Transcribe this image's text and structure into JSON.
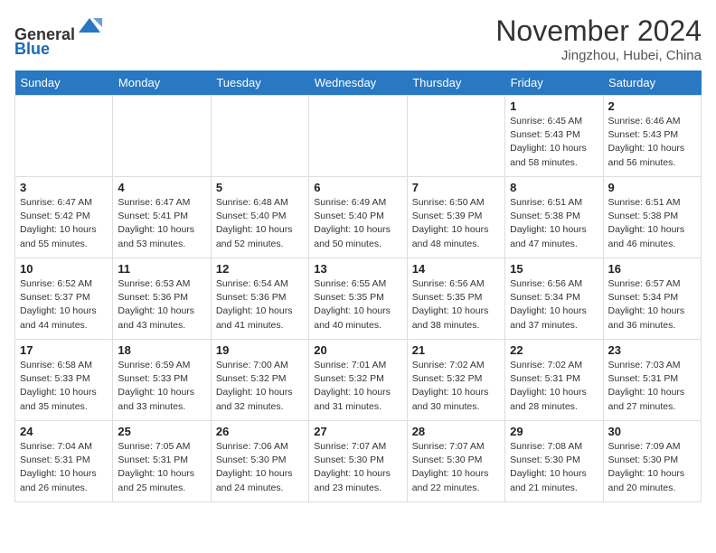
{
  "header": {
    "logo_general": "General",
    "logo_blue": "Blue",
    "month_title": "November 2024",
    "location": "Jingzhou, Hubei, China"
  },
  "days_of_week": [
    "Sunday",
    "Monday",
    "Tuesday",
    "Wednesday",
    "Thursday",
    "Friday",
    "Saturday"
  ],
  "weeks": [
    [
      {
        "day": "",
        "info": ""
      },
      {
        "day": "",
        "info": ""
      },
      {
        "day": "",
        "info": ""
      },
      {
        "day": "",
        "info": ""
      },
      {
        "day": "",
        "info": ""
      },
      {
        "day": "1",
        "info": "Sunrise: 6:45 AM\nSunset: 5:43 PM\nDaylight: 10 hours and 58 minutes."
      },
      {
        "day": "2",
        "info": "Sunrise: 6:46 AM\nSunset: 5:43 PM\nDaylight: 10 hours and 56 minutes."
      }
    ],
    [
      {
        "day": "3",
        "info": "Sunrise: 6:47 AM\nSunset: 5:42 PM\nDaylight: 10 hours and 55 minutes."
      },
      {
        "day": "4",
        "info": "Sunrise: 6:47 AM\nSunset: 5:41 PM\nDaylight: 10 hours and 53 minutes."
      },
      {
        "day": "5",
        "info": "Sunrise: 6:48 AM\nSunset: 5:40 PM\nDaylight: 10 hours and 52 minutes."
      },
      {
        "day": "6",
        "info": "Sunrise: 6:49 AM\nSunset: 5:40 PM\nDaylight: 10 hours and 50 minutes."
      },
      {
        "day": "7",
        "info": "Sunrise: 6:50 AM\nSunset: 5:39 PM\nDaylight: 10 hours and 48 minutes."
      },
      {
        "day": "8",
        "info": "Sunrise: 6:51 AM\nSunset: 5:38 PM\nDaylight: 10 hours and 47 minutes."
      },
      {
        "day": "9",
        "info": "Sunrise: 6:51 AM\nSunset: 5:38 PM\nDaylight: 10 hours and 46 minutes."
      }
    ],
    [
      {
        "day": "10",
        "info": "Sunrise: 6:52 AM\nSunset: 5:37 PM\nDaylight: 10 hours and 44 minutes."
      },
      {
        "day": "11",
        "info": "Sunrise: 6:53 AM\nSunset: 5:36 PM\nDaylight: 10 hours and 43 minutes."
      },
      {
        "day": "12",
        "info": "Sunrise: 6:54 AM\nSunset: 5:36 PM\nDaylight: 10 hours and 41 minutes."
      },
      {
        "day": "13",
        "info": "Sunrise: 6:55 AM\nSunset: 5:35 PM\nDaylight: 10 hours and 40 minutes."
      },
      {
        "day": "14",
        "info": "Sunrise: 6:56 AM\nSunset: 5:35 PM\nDaylight: 10 hours and 38 minutes."
      },
      {
        "day": "15",
        "info": "Sunrise: 6:56 AM\nSunset: 5:34 PM\nDaylight: 10 hours and 37 minutes."
      },
      {
        "day": "16",
        "info": "Sunrise: 6:57 AM\nSunset: 5:34 PM\nDaylight: 10 hours and 36 minutes."
      }
    ],
    [
      {
        "day": "17",
        "info": "Sunrise: 6:58 AM\nSunset: 5:33 PM\nDaylight: 10 hours and 35 minutes."
      },
      {
        "day": "18",
        "info": "Sunrise: 6:59 AM\nSunset: 5:33 PM\nDaylight: 10 hours and 33 minutes."
      },
      {
        "day": "19",
        "info": "Sunrise: 7:00 AM\nSunset: 5:32 PM\nDaylight: 10 hours and 32 minutes."
      },
      {
        "day": "20",
        "info": "Sunrise: 7:01 AM\nSunset: 5:32 PM\nDaylight: 10 hours and 31 minutes."
      },
      {
        "day": "21",
        "info": "Sunrise: 7:02 AM\nSunset: 5:32 PM\nDaylight: 10 hours and 30 minutes."
      },
      {
        "day": "22",
        "info": "Sunrise: 7:02 AM\nSunset: 5:31 PM\nDaylight: 10 hours and 28 minutes."
      },
      {
        "day": "23",
        "info": "Sunrise: 7:03 AM\nSunset: 5:31 PM\nDaylight: 10 hours and 27 minutes."
      }
    ],
    [
      {
        "day": "24",
        "info": "Sunrise: 7:04 AM\nSunset: 5:31 PM\nDaylight: 10 hours and 26 minutes."
      },
      {
        "day": "25",
        "info": "Sunrise: 7:05 AM\nSunset: 5:31 PM\nDaylight: 10 hours and 25 minutes."
      },
      {
        "day": "26",
        "info": "Sunrise: 7:06 AM\nSunset: 5:30 PM\nDaylight: 10 hours and 24 minutes."
      },
      {
        "day": "27",
        "info": "Sunrise: 7:07 AM\nSunset: 5:30 PM\nDaylight: 10 hours and 23 minutes."
      },
      {
        "day": "28",
        "info": "Sunrise: 7:07 AM\nSunset: 5:30 PM\nDaylight: 10 hours and 22 minutes."
      },
      {
        "day": "29",
        "info": "Sunrise: 7:08 AM\nSunset: 5:30 PM\nDaylight: 10 hours and 21 minutes."
      },
      {
        "day": "30",
        "info": "Sunrise: 7:09 AM\nSunset: 5:30 PM\nDaylight: 10 hours and 20 minutes."
      }
    ]
  ]
}
